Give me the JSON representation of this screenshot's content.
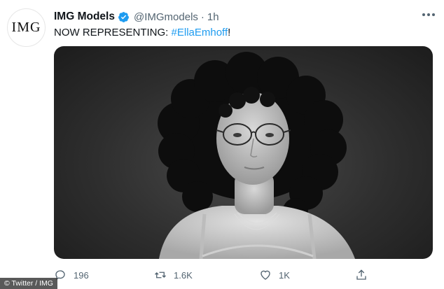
{
  "account": {
    "avatar_text": "IMG",
    "name": "IMG Models",
    "handle": "@IMGmodels",
    "separator": "·",
    "time": "1h"
  },
  "tweet": {
    "text_prefix": "NOW REPRESENTING: ",
    "hashtag": "#EllaEmhoff",
    "text_suffix": "!"
  },
  "actions": {
    "reply_count": "196",
    "retweet_count": "1.6K",
    "like_count": "1K"
  },
  "icons": {
    "verified": "verified-badge-icon",
    "more": "more-icon",
    "reply": "reply-icon",
    "retweet": "retweet-icon",
    "like": "heart-icon",
    "share": "share-icon"
  },
  "colors": {
    "accent": "#1d9bf0",
    "muted": "#536471",
    "text": "#0f1419"
  },
  "credit": "© Twitter / IMG"
}
